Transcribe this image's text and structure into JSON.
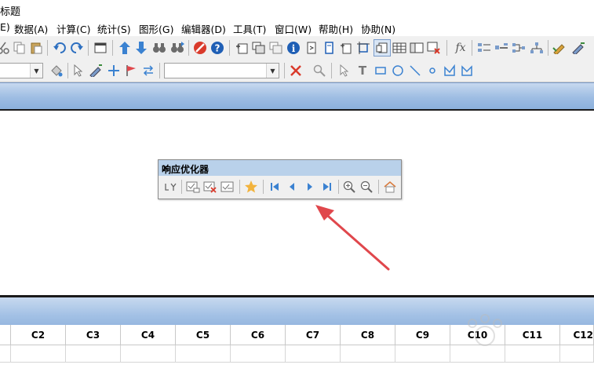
{
  "window": {
    "title_fragment": "标题"
  },
  "menu": [
    "E)",
    "数据(A)",
    "计算(C)",
    "统计(S)",
    "图形(G)",
    "编辑器(D)",
    "工具(T)",
    "窗口(W)",
    "帮助(H)",
    "协助(N)"
  ],
  "toolbar1": {
    "icons": [
      "cut-icon",
      "copy-icon",
      "paste-icon",
      "undo-icon",
      "redo-icon",
      "window-icon",
      "arrow-up-icon",
      "arrow-down-icon",
      "find-icon",
      "find-next-icon",
      "cancel-icon",
      "help-icon",
      "new-graph-icon",
      "layer-icon",
      "copy-layer-icon",
      "info-icon",
      "report-icon",
      "notepad-icon",
      "new-doc-icon",
      "crop-icon",
      "doc-icon",
      "table-icon",
      "panel-icon",
      "close-panel-icon",
      "fx-icon",
      "dots-icon",
      "minus-icon",
      "tree-icon",
      "edit-icon",
      "brush-icon"
    ],
    "fx_label": "fx"
  },
  "toolbar2": {
    "combo1_value": "",
    "combo2_value": "",
    "icons": [
      "paint-icon",
      "select-arrow-icon",
      "brush-icon",
      "plus-icon",
      "flag-icon",
      "swap-icon",
      "delete-icon",
      "search-icon",
      "pointer-icon",
      "text-icon",
      "rect-icon",
      "ellipse-icon",
      "line-icon",
      "dot-icon",
      "polyline-icon",
      "polygon-icon"
    ],
    "text_tool": "T"
  },
  "dialog": {
    "title": "响应优化器",
    "close": "✕",
    "buttons": [
      "response-icon",
      "add-icon",
      "remove-icon",
      "check-icon",
      "star-icon",
      "first-icon",
      "prev-icon",
      "next-icon",
      "last-icon",
      "zoom-in-icon",
      "zoom-out-icon",
      "home-icon"
    ]
  },
  "worksheet": {
    "columns": [
      "C2",
      "C3",
      "C4",
      "C5",
      "C6",
      "C7",
      "C8",
      "C9",
      "C10",
      "C11",
      "C12"
    ]
  },
  "colors": {
    "title_band": "#9ebde3",
    "dialog_title": "#b9d1ea",
    "annotation_arrow": "#e0474c"
  }
}
